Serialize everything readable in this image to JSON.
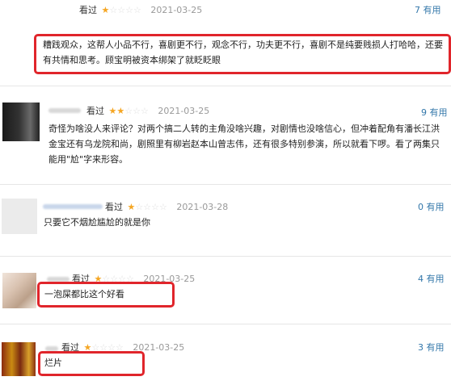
{
  "reviews": [
    {
      "seen": "看过",
      "stars_on": "★",
      "stars_off": "☆☆☆☆",
      "date": "2021-03-25",
      "useful_count": "7",
      "useful_label": "有用",
      "content": "糟践观众，这帮人小品不行，喜剧更不行，观念不行，功夫更不行，喜剧不是纯要贱损人打哈哈，还要有共情和思考。顾宝明被资本绑架了就眨眨眼"
    },
    {
      "seen": "看过",
      "stars_on": "★★",
      "stars_off": "☆☆☆",
      "date": "2021-03-25",
      "useful_count": "9",
      "useful_label": "有用",
      "content": "奇怪为啥没人来评论？对两个搞二人转的主角没啥兴趣，对剧情也没啥信心，但冲着配角有潘长江洪金宝还有乌龙院和尚，剧照里有柳岩赵本山曾志伟，还有很多特别参演，所以就看下啰。看了两集只能用\"尬\"字来形容。"
    },
    {
      "seen": "看过",
      "stars_on": "★",
      "stars_off": "☆☆☆☆",
      "date": "2021-03-28",
      "useful_count": "0",
      "useful_label": "有用",
      "content": "只要它不烟尬尴尬的就是你"
    },
    {
      "seen": "看过",
      "stars_on": "★",
      "stars_off": "☆☆☆☆",
      "date": "2021-03-25",
      "useful_count": "4",
      "useful_label": "有用",
      "content": "一泡屎都比这个好看"
    },
    {
      "seen": "看过",
      "stars_on": "★",
      "stars_off": "☆☆☆☆",
      "date": "2021-03-25",
      "useful_count": "3",
      "useful_label": "有用",
      "content": "烂片"
    }
  ],
  "colors": {
    "highlight_box": "#e0252b",
    "star_on": "#f5a623",
    "star_off": "#dedede",
    "useful_link": "#3377aa"
  }
}
